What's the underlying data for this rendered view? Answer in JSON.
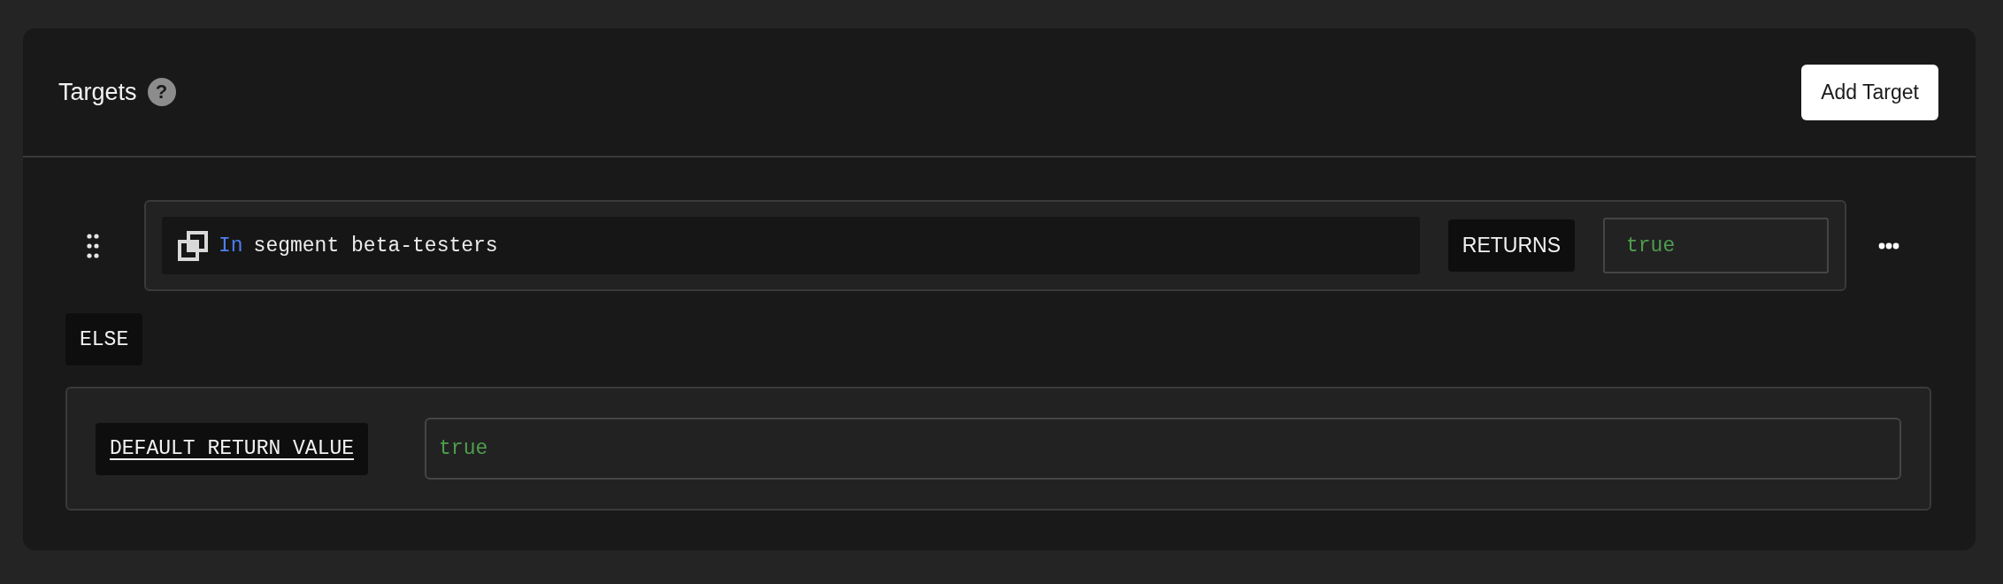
{
  "header": {
    "title": "Targets",
    "help": "?",
    "button": "Add Target"
  },
  "rules": [
    {
      "operator": "In",
      "condition": "segment beta-testers",
      "returns_label": "RETURNS",
      "value": "true"
    }
  ],
  "else_label": "ELSE",
  "default": {
    "label": "DEFAULT RETURN VALUE",
    "value": "true"
  }
}
